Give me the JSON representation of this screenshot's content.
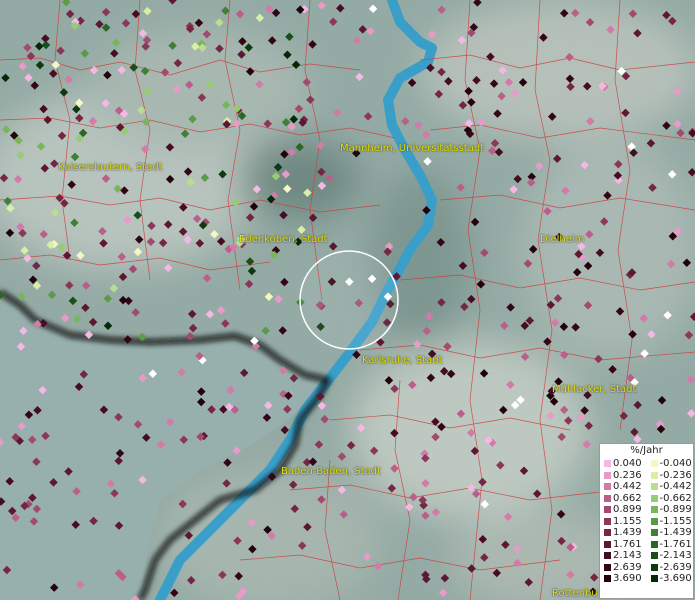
{
  "cities": [
    {
      "label": "Kaiserslautern, Stadt"
    },
    {
      "label": "Mannheim, Universitätsstadt"
    },
    {
      "label": "Edenkoben, Stadt"
    },
    {
      "label": "Dielheim"
    },
    {
      "label": "Karlsruhe, Stadt"
    },
    {
      "label": "Mühlacker, Stadt"
    },
    {
      "label": "Baden-Baden, Stadt"
    },
    {
      "label": "Rottenbu"
    }
  ],
  "legend": {
    "title": "%/Jahr",
    "rows": [
      {
        "pos": "0.040",
        "pos_color": "#f4b8e4",
        "neg": "-0.040",
        "neg_color": "#f3f8c0"
      },
      {
        "pos": "0.236",
        "pos_color": "#e89ac8",
        "neg": "-0.236",
        "neg_color": "#d9efa6"
      },
      {
        "pos": "0.442",
        "pos_color": "#d27aa8",
        "neg": "-0.442",
        "neg_color": "#b9df8c"
      },
      {
        "pos": "0.662",
        "pos_color": "#bb5f8a",
        "neg": "-0.662",
        "neg_color": "#98cc72"
      },
      {
        "pos": "0.899",
        "pos_color": "#a34a70",
        "neg": "-0.899",
        "neg_color": "#78b55c"
      },
      {
        "pos": "1.155",
        "pos_color": "#8c3758",
        "neg": "-1.155",
        "neg_color": "#5a9a48"
      },
      {
        "pos": "1.439",
        "pos_color": "#742644",
        "neg": "-1.439",
        "neg_color": "#3f8035"
      },
      {
        "pos": "1.761",
        "pos_color": "#5c1832",
        "neg": "-1.761",
        "neg_color": "#2a6626"
      },
      {
        "pos": "2.143",
        "pos_color": "#460d22",
        "neg": "-2.143",
        "neg_color": "#1a4e19"
      },
      {
        "pos": "2.639",
        "pos_color": "#330616",
        "neg": "-2.639",
        "neg_color": "#0f3a10"
      },
      {
        "pos": "3.690",
        "pos_color": "#22020c",
        "neg": "-3.690",
        "neg_color": "#072808"
      }
    ]
  },
  "colors": {
    "terrain": "#8fa8a2",
    "water": "#3a9fc8",
    "borders": "#d03a3a",
    "state_border": "#111111",
    "label": "#e0e000",
    "selection_circle": "#ffffff"
  }
}
